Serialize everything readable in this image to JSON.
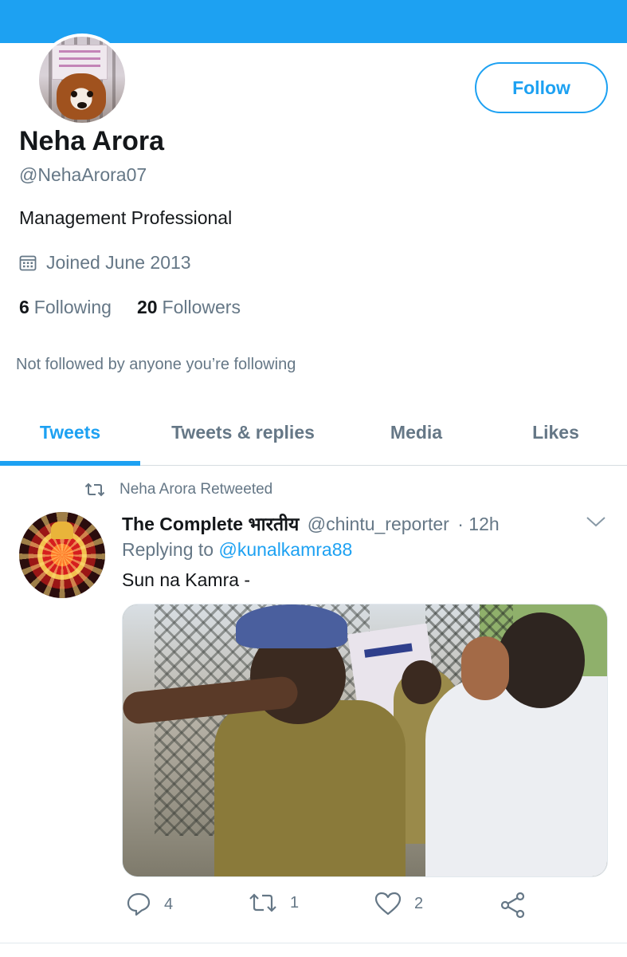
{
  "profile": {
    "name": "Neha Arora",
    "handle": "@NehaArora07",
    "bio": "Management Professional",
    "joined": "Joined June 2013",
    "following_count": "6",
    "following_label": "Following",
    "followers_count": "20",
    "followers_label": "Followers",
    "not_followed_note": "Not followed by anyone you’re following",
    "follow_button": "Follow"
  },
  "tabs": [
    {
      "label": "Tweets",
      "active": true
    },
    {
      "label": "Tweets & replies",
      "active": false
    },
    {
      "label": "Media",
      "active": false
    },
    {
      "label": "Likes",
      "active": false
    }
  ],
  "tweet": {
    "retweeted_by": "Neha Arora Retweeted",
    "author": "The Complete भारतीय",
    "author_handle": "@chintu_reporter",
    "time": "· 12h",
    "replying_prefix": "Replying to",
    "replying_to": "@kunalkamra88",
    "text": "Sun na Kamra -",
    "replies": "4",
    "retweets": "1",
    "likes": "2"
  },
  "colors": {
    "accent": "#1da1f2",
    "text": "#14171a",
    "muted": "#657786"
  }
}
